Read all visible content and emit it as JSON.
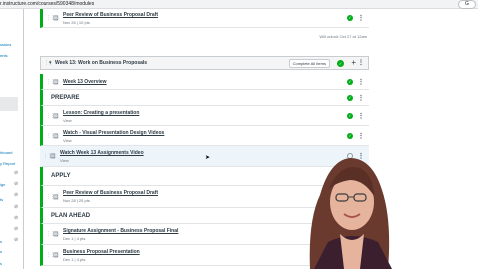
{
  "browser": {
    "url": "r.instructure.com/courses/590348/modules",
    "profile_button": "G"
  },
  "sidebar": {
    "links": [
      "ssions",
      "ents",
      "hboard",
      "y Report",
      "ign",
      "ts",
      "s",
      "s",
      "s"
    ]
  },
  "top_item": {
    "title": "Peer Review of Business Proposal Draft",
    "meta": "Nov 26 | 10 pts",
    "unlock_note": "Will unlock Oct 27 at 12am"
  },
  "module": {
    "title": "Week 13: Work on Business Proposals",
    "complete_all": "Complete All Items"
  },
  "rows": [
    {
      "title": "Week 13 Overview",
      "meta": ""
    },
    {
      "header": "PREPARE"
    },
    {
      "title": "Lesson: Creating a presentation",
      "meta": "View"
    },
    {
      "title": "Watch - Visual Presentation Design Videos",
      "meta": "View"
    },
    {
      "title": "Watch Week 13 Assignments Video",
      "meta": "View"
    },
    {
      "header": "APPLY"
    },
    {
      "title": "Peer Review of Business Proposal Draft",
      "meta": "Nov 28 | 25 pts"
    },
    {
      "header": "PLAN AHEAD"
    },
    {
      "title": "Signature Assignment - Business Proposal Final",
      "meta": "Dec 1 | 4 pts"
    },
    {
      "title": "Business Proposal Presentation",
      "meta": "Dec 1 | 4 pts"
    }
  ],
  "colors": {
    "success": "#00ac18",
    "link": "#0374b5"
  },
  "icons": {
    "drag": "drag-handle-icon",
    "doc": "document-icon",
    "check": "checkmark-circle-icon",
    "menu": "kebab-menu-icon"
  }
}
